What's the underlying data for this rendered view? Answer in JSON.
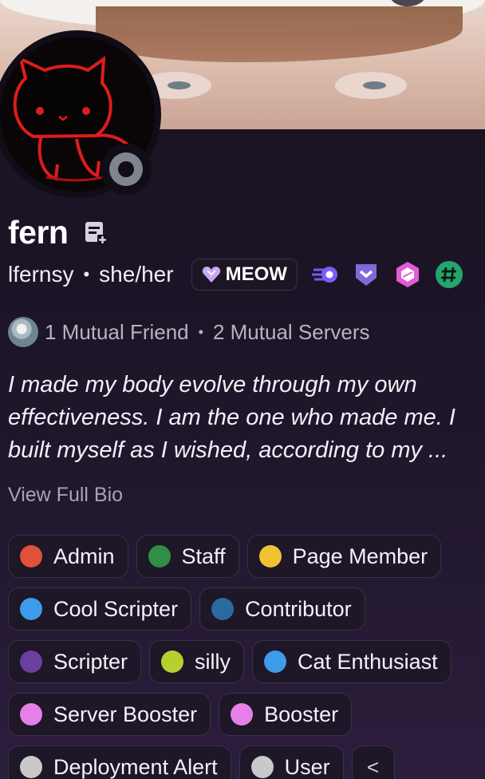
{
  "profile": {
    "display_name": "fern",
    "username": "lfernsy",
    "separator": "•",
    "pronouns": "she/her",
    "guild_tag": "MEOW",
    "status": "offline",
    "note_icon": "add-note-icon",
    "badges": [
      "hypesquad-balance-icon",
      "active-developer-icon",
      "nitro-gem-icon",
      "quest-badge-icon"
    ]
  },
  "mutuals": {
    "friends": "1 Mutual Friend",
    "separator": "•",
    "servers": "2 Mutual Servers"
  },
  "bio": {
    "text": "I made my body evolve through my own effectiveness. I am the one who made me. I built myself as I wished, according to my ...",
    "view_full": "View Full Bio"
  },
  "roles": [
    {
      "label": "Admin",
      "color": "#e0503a"
    },
    {
      "label": "Staff",
      "color": "#2f8f46"
    },
    {
      "label": "Page Member",
      "color": "#f1c232"
    },
    {
      "label": "Cool Scripter",
      "color": "#3d9be9"
    },
    {
      "label": "Contributor",
      "color": "#2b6a9e"
    },
    {
      "label": "Scripter",
      "color": "#6b3fa0"
    },
    {
      "label": "silly",
      "color": "#b6d12f"
    },
    {
      "label": "Cat Enthusiast",
      "color": "#3d9be9"
    },
    {
      "label": "Server Booster",
      "color": "#e77fe8"
    },
    {
      "label": "Booster",
      "color": "#e77fe8"
    },
    {
      "label": "Deployment Alert",
      "color": "#c9c9c9"
    },
    {
      "label": "User",
      "color": "#c9c9c9"
    }
  ],
  "collapse_label": "<"
}
